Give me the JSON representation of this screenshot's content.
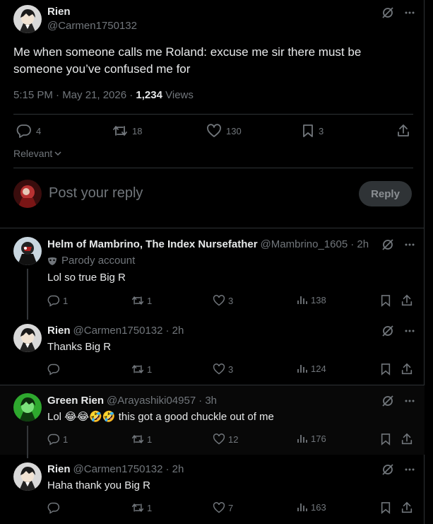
{
  "main_tweet": {
    "author_name": "Rien",
    "author_handle": "@Carmen1750132",
    "text": "Me when someone calls me Roland: excuse me sir there must be someone you’ve confused me for",
    "time": "5:15 PM · May 21, 2026 · ",
    "views_count": "1,234",
    "views_label": " Views",
    "stats": {
      "replies": "4",
      "reposts": "18",
      "likes": "130",
      "bookmarks": "3"
    },
    "sort_label": "Relevant"
  },
  "reply_composer": {
    "placeholder": "Post your reply",
    "button_label": "Reply"
  },
  "replies": [
    {
      "name": "Helm of Mambrino, The Index Nursefather",
      "handle": "@Mambrino_1605",
      "time": "· 2h",
      "badge": "Parody account",
      "text": "Lol so true Big R",
      "replies": "1",
      "reposts": "1",
      "likes": "3",
      "views": "138"
    },
    {
      "name": "Rien",
      "handle": "@Carmen1750132",
      "time": "· 2h",
      "text": "Thanks Big R",
      "replies": "",
      "reposts": "1",
      "likes": "3",
      "views": "124"
    },
    {
      "name": "Green Rien",
      "handle": "@Arayashiki04957",
      "time": "· 3h",
      "text": "Lol 😂😂🤣🤣 this got a good chuckle out of me",
      "replies": "1",
      "reposts": "1",
      "likes": "12",
      "views": "176"
    },
    {
      "name": "Rien",
      "handle": "@Carmen1750132",
      "time": "· 2h",
      "text": "Haha thank you Big R",
      "replies": "",
      "reposts": "1",
      "likes": "7",
      "views": "163"
    }
  ]
}
